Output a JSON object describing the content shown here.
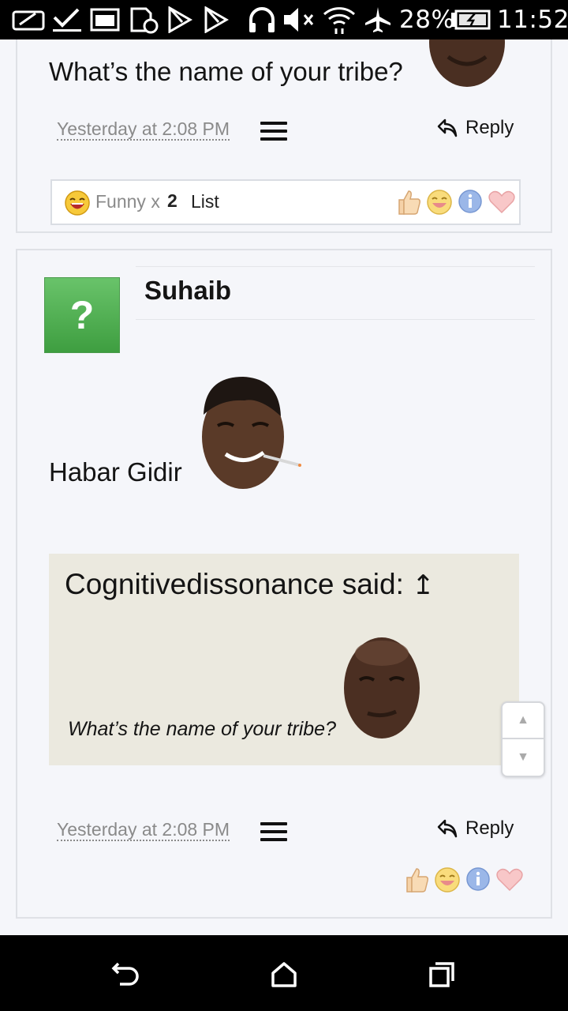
{
  "status_bar": {
    "battery_percent": "28%",
    "time": "11:52",
    "icons": [
      "signature-icon",
      "checkmark-icon",
      "image-icon",
      "sd-card-sync-icon",
      "play-store-icon",
      "play-store-icon",
      "headphones-icon",
      "mute-icon",
      "wifi-icon",
      "airplane-icon",
      "battery-charging-icon"
    ]
  },
  "post1": {
    "message": "What’s the name of your tribe?",
    "date": "Yesterday at 2:08 PM",
    "reply_label": "Reply",
    "reactions_summary": {
      "label": "Funny x",
      "count": "2",
      "list_label": "List"
    },
    "reaction_icons": [
      "like-icon",
      "funny-icon",
      "info-icon",
      "love-icon"
    ]
  },
  "post2": {
    "username": "Suhaib",
    "avatar_text": "?",
    "message": "Habar Gidir",
    "quote": {
      "attribution": "Cognitivedissonance said:",
      "text": "What’s the name of your tribe?"
    },
    "date": "Yesterday at 2:08 PM",
    "reply_label": "Reply",
    "reaction_icons": [
      "like-icon",
      "funny-icon",
      "info-icon",
      "love-icon"
    ]
  },
  "scroll_widget": {
    "up_label": "▲",
    "down_label": "▼"
  },
  "nav_bar": {
    "buttons": [
      "back-icon",
      "home-icon",
      "recents-icon"
    ]
  },
  "colors": {
    "avatar_green": "#5cb85c",
    "quote_bg": "#ebe9df",
    "page_bg": "#f5f6fa"
  }
}
